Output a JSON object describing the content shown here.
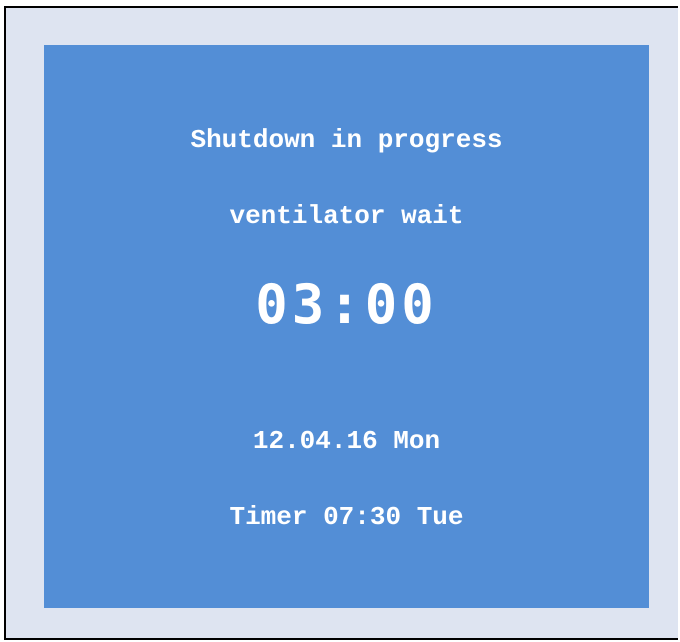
{
  "display": {
    "status": "Shutdown in progress",
    "substatus": "ventilator wait",
    "countdown": "03:00",
    "date": "12.04.16 Mon",
    "timer": "Timer 07:30 Tue"
  },
  "colors": {
    "background": "#dee4f1",
    "screen": "#538ed6",
    "text": "#ffffff"
  }
}
